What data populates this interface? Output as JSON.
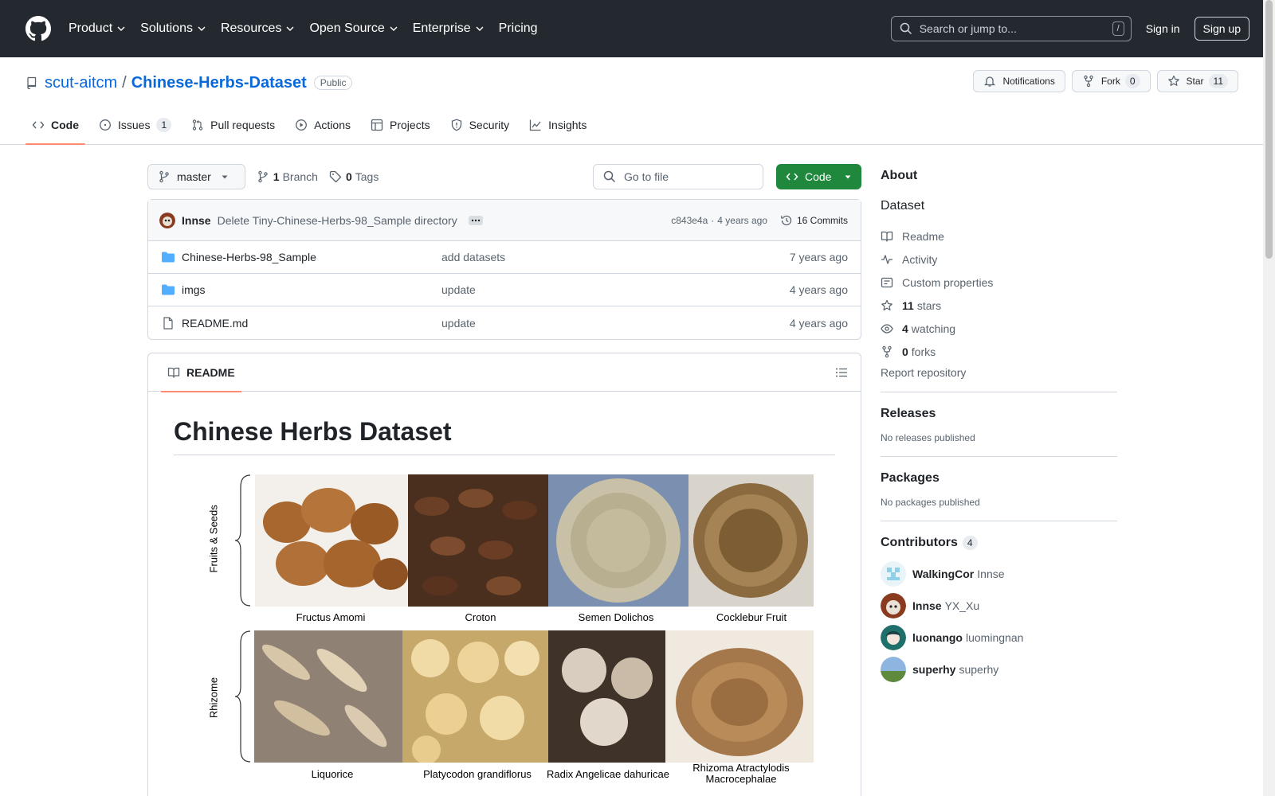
{
  "header": {
    "nav": [
      "Product",
      "Solutions",
      "Resources",
      "Open Source",
      "Enterprise",
      "Pricing"
    ],
    "search_placeholder": "Search or jump to...",
    "search_key": "/",
    "sign_in": "Sign in",
    "sign_up": "Sign up"
  },
  "repo": {
    "owner": "scut-aitcm",
    "separator": "/",
    "name": "Chinese-Herbs-Dataset",
    "visibility": "Public",
    "notifications": "Notifications",
    "fork": "Fork",
    "fork_count": "0",
    "star": "Star",
    "star_count": "11"
  },
  "tabs": [
    {
      "label": "Code",
      "active": true,
      "icon": "code-icon"
    },
    {
      "label": "Issues",
      "count": "1",
      "icon": "issue-icon"
    },
    {
      "label": "Pull requests",
      "icon": "pull-request-icon"
    },
    {
      "label": "Actions",
      "icon": "play-icon"
    },
    {
      "label": "Projects",
      "icon": "table-icon"
    },
    {
      "label": "Security",
      "icon": "shield-icon"
    },
    {
      "label": "Insights",
      "icon": "graph-icon"
    }
  ],
  "toolbar": {
    "branch": "master",
    "branches_count": "1",
    "branches_label": "Branch",
    "tags_count": "0",
    "tags_label": "Tags",
    "goto_placeholder": "Go to file",
    "code_button": "Code"
  },
  "commit": {
    "author": "Innse",
    "message": "Delete Tiny-Chinese-Herbs-98_Sample directory",
    "sha": "c843e4a",
    "dot": "·",
    "time": "4 years ago",
    "commits": "16 Commits"
  },
  "files": [
    {
      "type": "folder",
      "name": "Chinese-Herbs-98_Sample",
      "message": "add datasets",
      "date": "7 years ago"
    },
    {
      "type": "folder",
      "name": "imgs",
      "message": "update",
      "date": "4 years ago"
    },
    {
      "type": "file",
      "name": "README.md",
      "message": "update",
      "date": "4 years ago"
    }
  ],
  "readme": {
    "tab_label": "README",
    "title": "Chinese Herbs Dataset",
    "groups": [
      {
        "label": "Fruits & Seeds",
        "items": [
          "Fructus Amomi",
          "Croton",
          "Semen Dolichos",
          "Cocklebur Fruit"
        ]
      },
      {
        "label": "Rhizome",
        "items": [
          "Liquorice",
          "Platycodon grandiflorus",
          "Radix Angelicae dahuricae",
          "Rhizoma Atractylodis Macrocephalae"
        ]
      }
    ]
  },
  "about": {
    "title": "About",
    "description": "Dataset",
    "readme": "Readme",
    "activity": "Activity",
    "custom_properties": "Custom properties",
    "stars_count": "11",
    "stars_label": "stars",
    "watching_count": "4",
    "watching_label": "watching",
    "forks_count": "0",
    "forks_label": "forks",
    "report": "Report repository"
  },
  "releases": {
    "title": "Releases",
    "note": "No releases published"
  },
  "packages": {
    "title": "Packages",
    "note": "No packages published"
  },
  "contributors": {
    "title": "Contributors",
    "count": "4",
    "list": [
      {
        "login": "WalkingCor",
        "alias": "Innse"
      },
      {
        "login": "Innse",
        "alias": "YX_Xu"
      },
      {
        "login": "luonango",
        "alias": "luomingnan"
      },
      {
        "login": "superhy",
        "alias": "superhy"
      }
    ]
  },
  "colors": {
    "accent": "#0969da",
    "primary_button": "#1f883d",
    "header_bg": "#24292f",
    "tab_underline": "#fd8c73"
  }
}
